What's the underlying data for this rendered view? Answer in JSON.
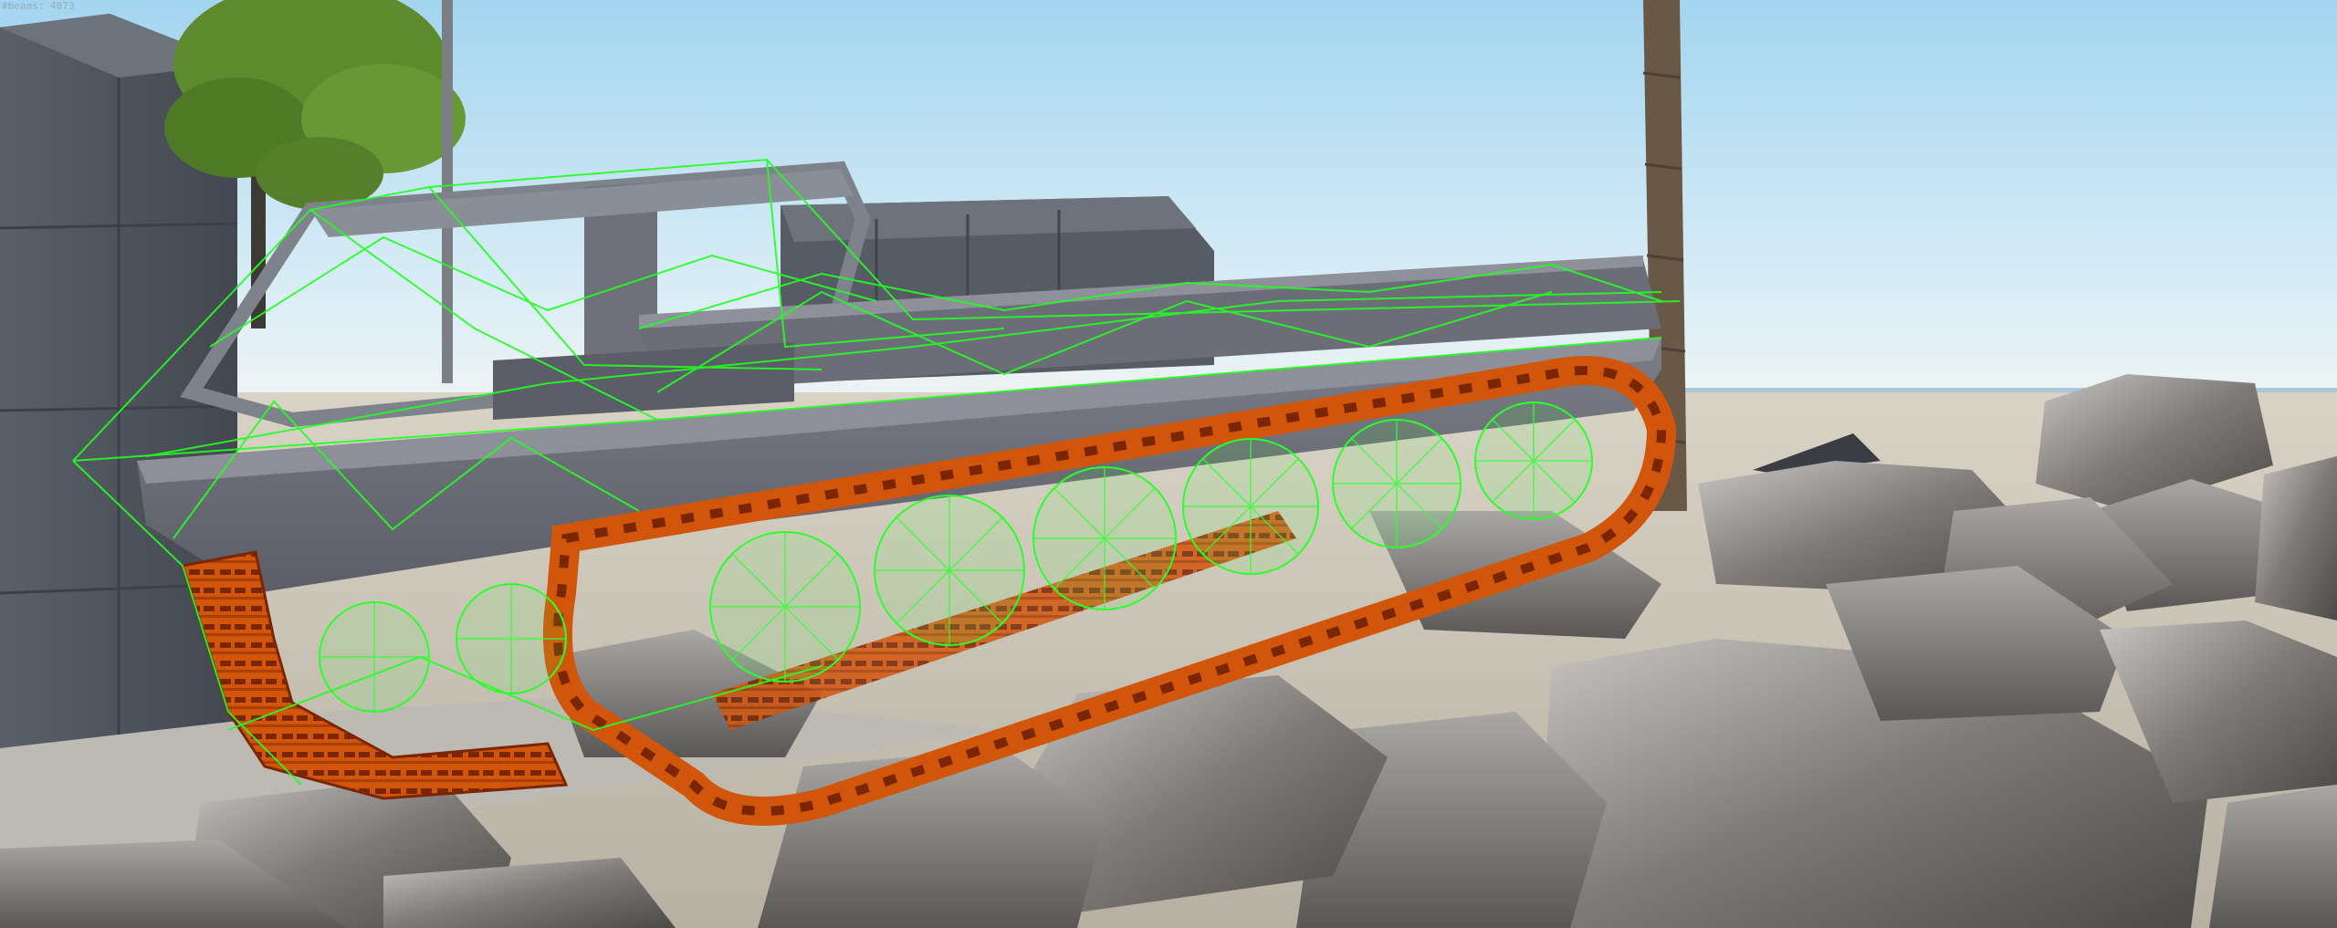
{
  "hud": {
    "beam_counter": "#beams: 4073"
  },
  "scene": {
    "colors": {
      "sky_top": "#9fd4f0",
      "sky_bottom": "#e2eef3",
      "ground": "#c9c3b6",
      "vehicle_body": "#6b6e76",
      "vehicle_body_light": "#8a8d95",
      "track": "#d2550c",
      "track_dark": "#8a2c05",
      "beam_wireframe": "#22ff22",
      "rock": "#6f6c6a",
      "rock_light": "#b9b7b4",
      "wall": "#4f555d",
      "tree_foliage": "#5e8a2e",
      "palm_trunk": "#6b5a46"
    },
    "icons": {
      "vehicle": "tracked-vehicle-icon",
      "wireframe": "beam-wireframe-icon"
    }
  }
}
